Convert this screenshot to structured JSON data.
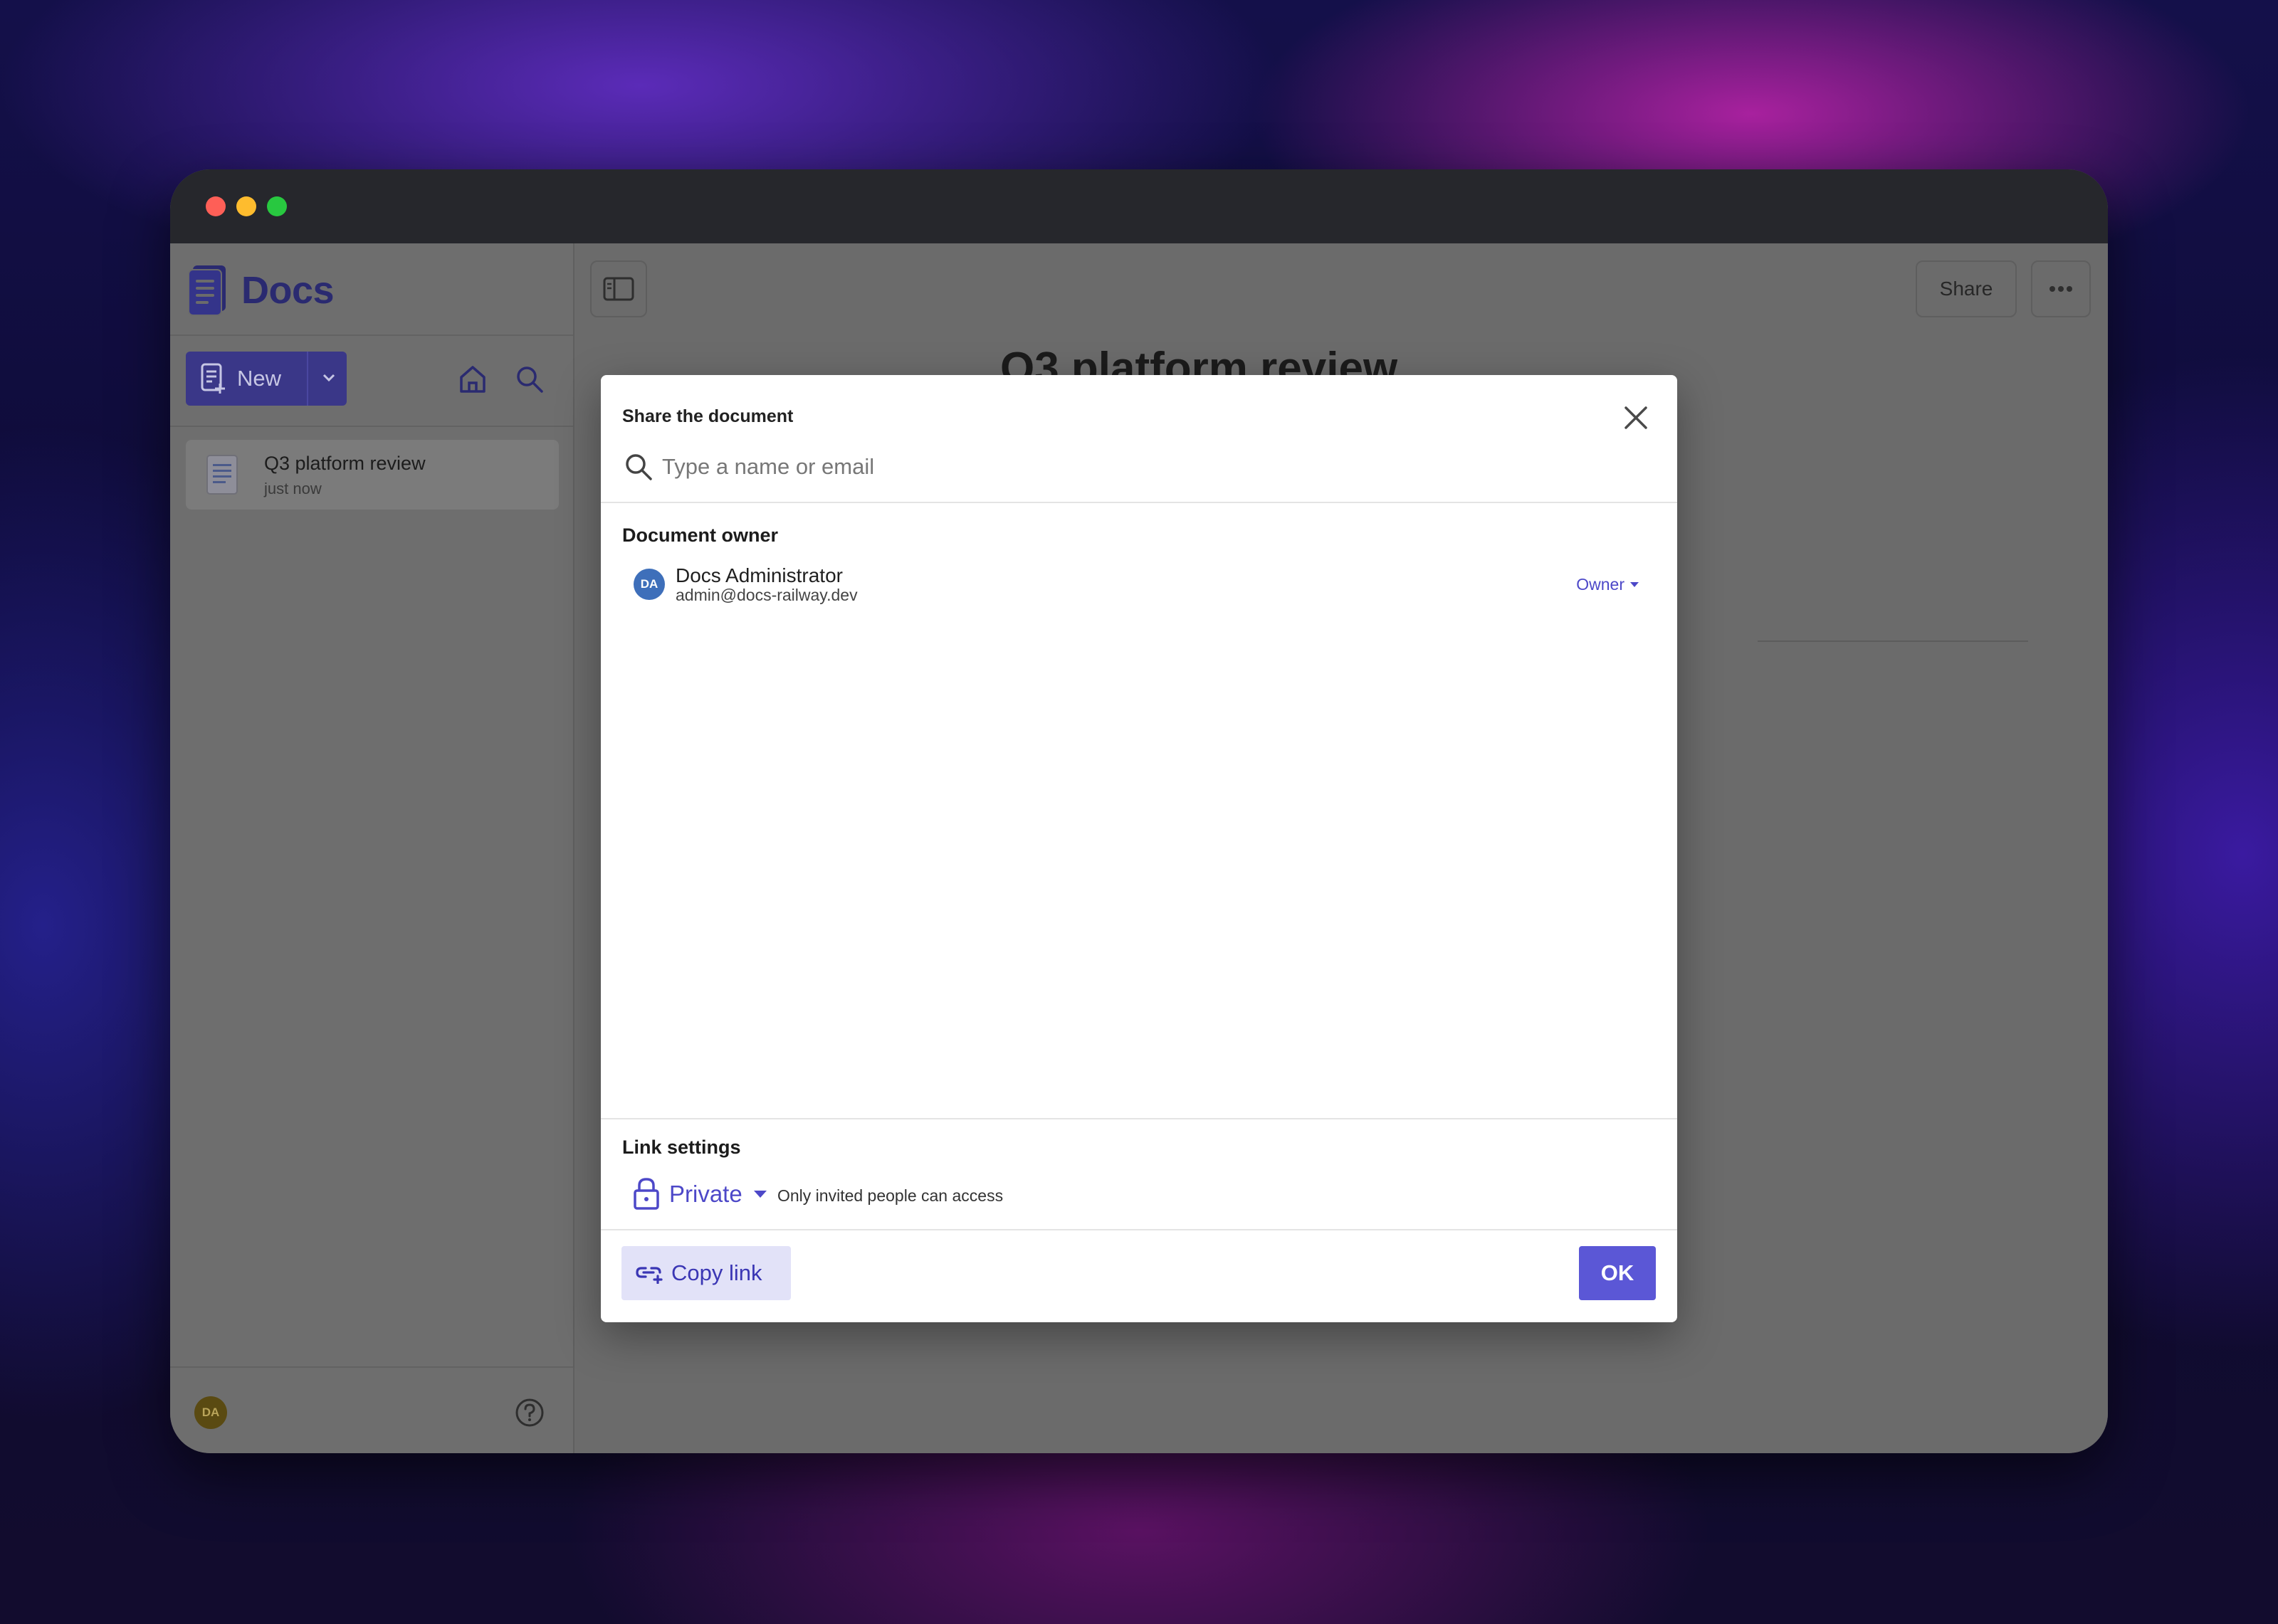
{
  "app": {
    "name": "Docs"
  },
  "sidebar": {
    "new_button_label": "New",
    "documents": [
      {
        "title": "Q3 platform review",
        "time": "just now"
      }
    ],
    "user_initials": "DA"
  },
  "main": {
    "document_title": "Q3 platform review",
    "share_label": "Share"
  },
  "share_dialog": {
    "title": "Share the document",
    "search_placeholder": "Type a name or email",
    "owner_section_label": "Document owner",
    "owner": {
      "initials": "DA",
      "name": "Docs Administrator",
      "email": "admin@docs-railway.dev",
      "role": "Owner"
    },
    "link_settings_label": "Link settings",
    "link_privacy": "Private",
    "link_privacy_description": "Only invited people can access",
    "copy_link_label": "Copy link",
    "ok_label": "OK"
  },
  "colors": {
    "accent": "#5b57d6",
    "accent_text": "#4d48c8",
    "owner_avatar": "#3e6fba"
  }
}
